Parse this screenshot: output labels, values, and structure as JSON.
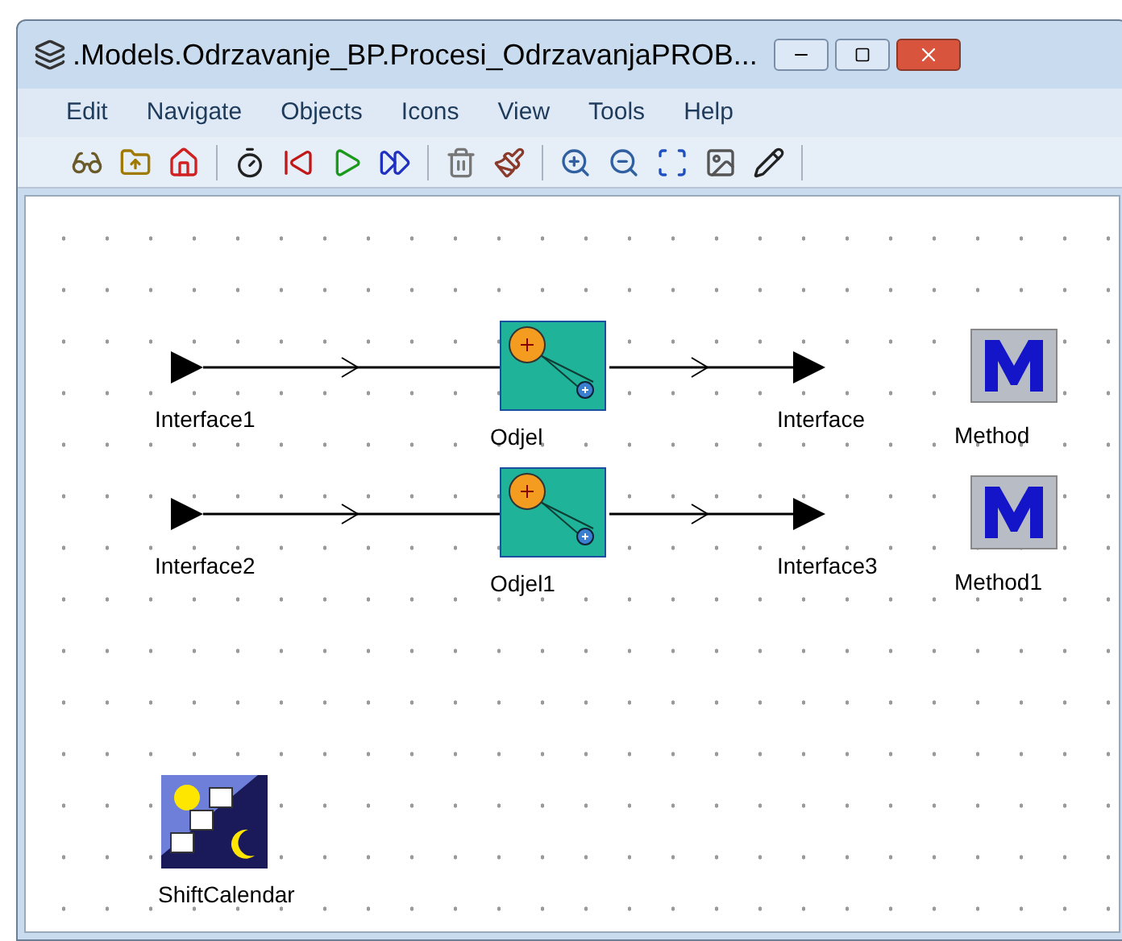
{
  "window": {
    "title": ".Models.Odrzavanje_BP.Procesi_OdrzavanjaPROB..."
  },
  "menu": [
    "Edit",
    "Navigate",
    "Objects",
    "Icons",
    "View",
    "Tools",
    "Help"
  ],
  "canvas": {
    "nodes": [
      {
        "kind": "interface",
        "label": "Interface1"
      },
      {
        "kind": "process",
        "label": "Odjel"
      },
      {
        "kind": "interface",
        "label": "Interface"
      },
      {
        "kind": "method",
        "label": "Method"
      },
      {
        "kind": "interface",
        "label": "Interface2"
      },
      {
        "kind": "process",
        "label": "Odjel1"
      },
      {
        "kind": "interface",
        "label": "Interface3"
      },
      {
        "kind": "method",
        "label": "Method1"
      },
      {
        "kind": "calendar",
        "label": "ShiftCalendar"
      }
    ]
  }
}
